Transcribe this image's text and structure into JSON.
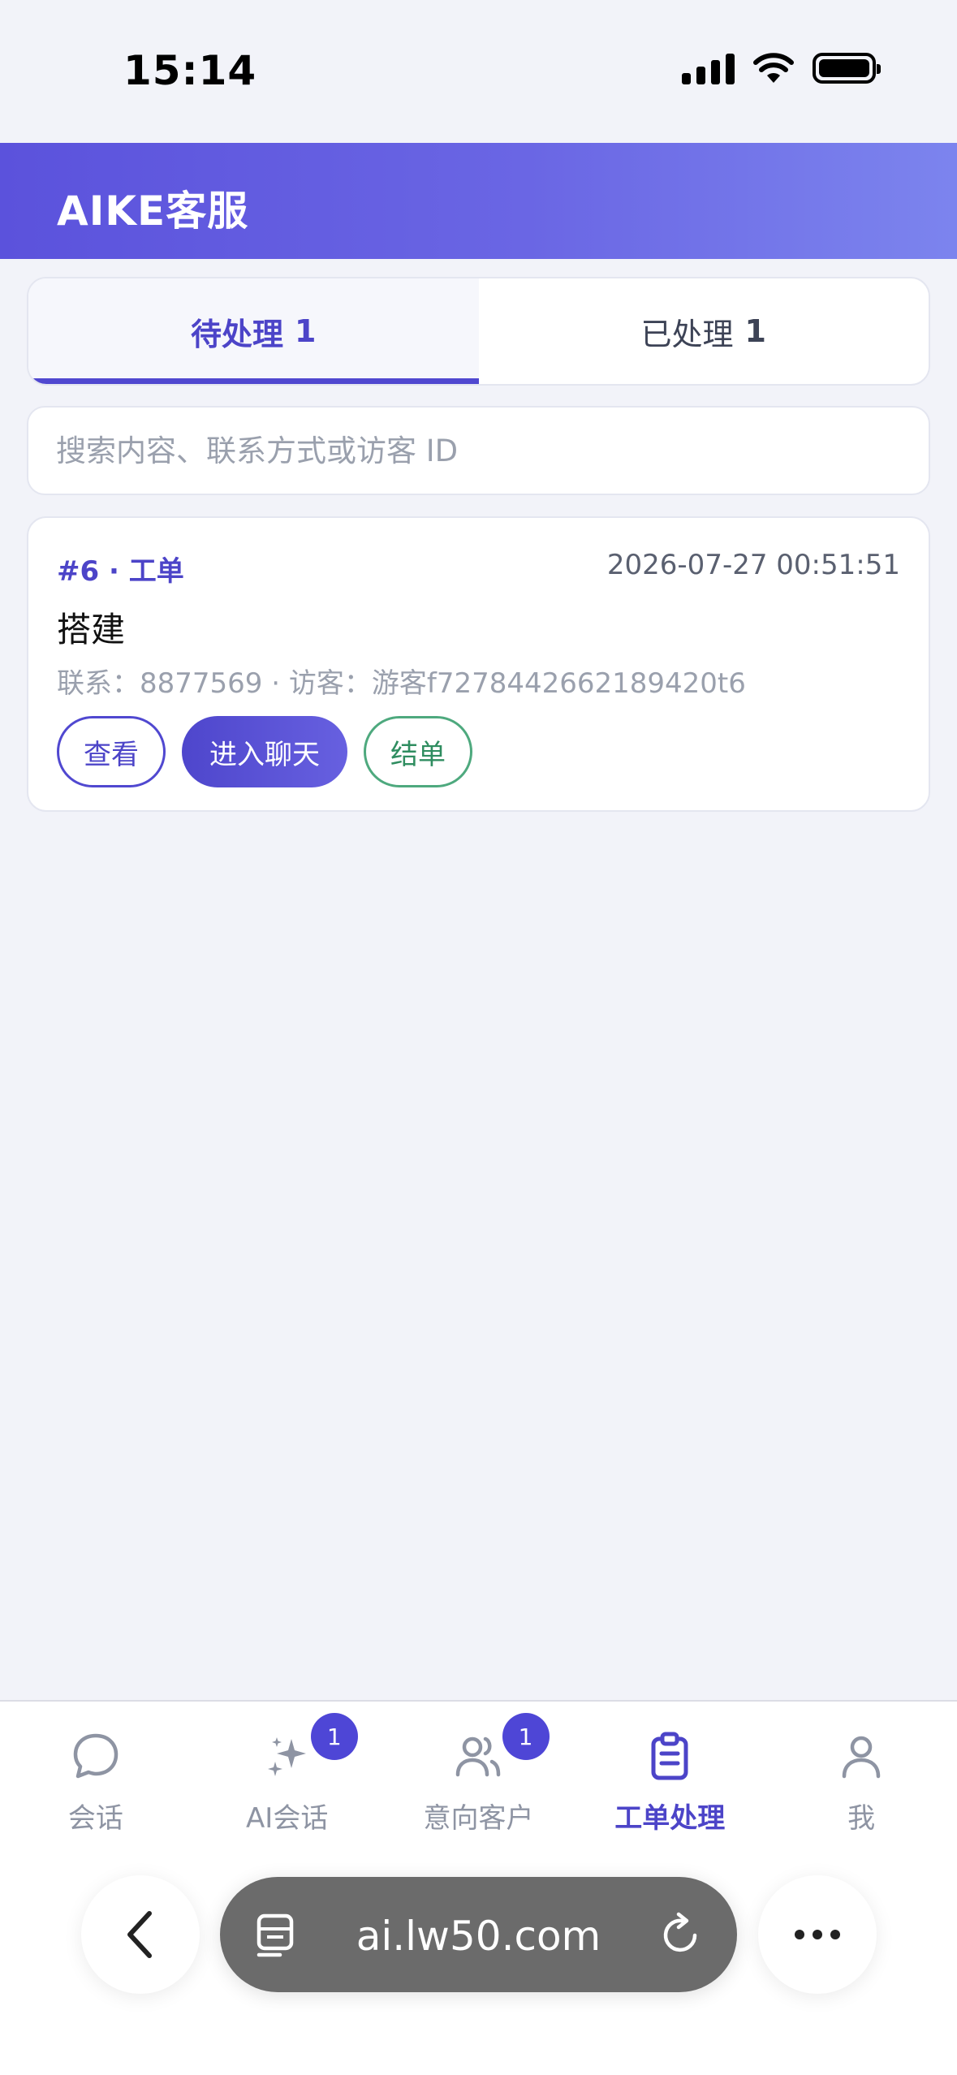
{
  "status_bar": {
    "time": "15:14"
  },
  "header": {
    "title": "AIKE客服"
  },
  "tabs": [
    {
      "label": "待处理",
      "count": "1",
      "active": true
    },
    {
      "label": "已处理",
      "count": "1",
      "active": false
    }
  ],
  "search": {
    "placeholder": "搜索内容、联系方式或访客 ID",
    "value": ""
  },
  "ticket": {
    "id": "#6 · 工单",
    "time": "2026-07-27 00:51:51",
    "title": "搭建",
    "meta": "联系：8877569 · 访客：游客f7278442662189420t6",
    "actions": {
      "view": "查看",
      "chat": "进入聊天",
      "close": "结单"
    }
  },
  "nav": {
    "items": [
      {
        "label": "会话",
        "icon": "chat-bubble-icon",
        "badge": ""
      },
      {
        "label": "AI会话",
        "icon": "sparkle-icon",
        "badge": "1"
      },
      {
        "label": "意向客户",
        "icon": "users-icon",
        "badge": "1"
      },
      {
        "label": "工单处理",
        "icon": "clipboard-icon",
        "badge": "",
        "active": true
      },
      {
        "label": "我",
        "icon": "user-icon",
        "badge": ""
      }
    ]
  },
  "browser": {
    "url": "ai.lw50.com"
  },
  "colors": {
    "accent": "#5048d0",
    "success": "#4ea97e",
    "background": "#f2f3f9"
  }
}
